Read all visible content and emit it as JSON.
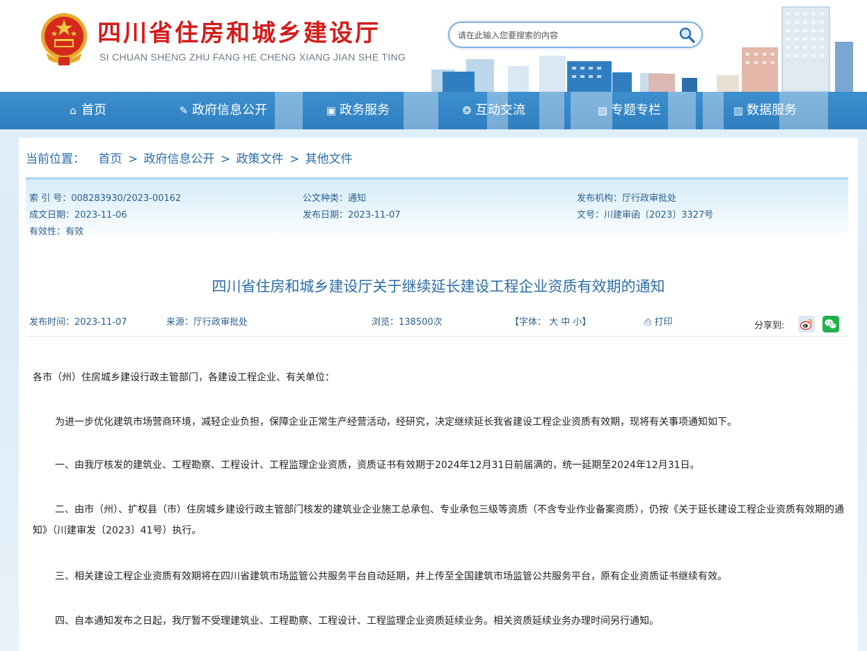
{
  "header": {
    "title": "四川省住房和城乡建设厅",
    "subtitle": "SI CHUAN SHENG ZHU FANG HE CHENG XIANG JIAN SHE TING",
    "emblem_icon": "national-emblem-icon",
    "search": {
      "placeholder": "请在此输入您要搜索的内容"
    }
  },
  "nav": {
    "items": [
      {
        "label": "首页",
        "icon": "home-icon"
      },
      {
        "label": "政府信息公开",
        "icon": "edit-icon"
      },
      {
        "label": "政务服务",
        "icon": "monitor-icon"
      },
      {
        "label": "互动交流",
        "icon": "chat-icon"
      },
      {
        "label": "专题专栏",
        "icon": "image-icon"
      },
      {
        "label": "数据服务",
        "icon": "chart-icon"
      }
    ]
  },
  "breadcrumb": {
    "label": "当前位置：",
    "items": [
      "首页",
      "政府信息公开",
      "政策文件",
      "其他文件"
    ],
    "separator": ">"
  },
  "meta": {
    "index_no": {
      "key": "索 引 号：",
      "value": "008283930/2023-00162"
    },
    "doc_type": {
      "key": "公文种类：",
      "value": "通知"
    },
    "publisher": {
      "key": "发布机构：",
      "value": "厅行政审批处"
    },
    "created_date": {
      "key": "成文日期：",
      "value": "2023-11-06"
    },
    "published_date": {
      "key": "发布日期：",
      "value": "2023-11-07"
    },
    "doc_no": {
      "key": "文号：",
      "value": "川建审函〔2023〕3327号"
    },
    "validity": {
      "key": "有效性：",
      "value": "有效"
    }
  },
  "article": {
    "title": "四川省住房和城乡建设厅关于继续延长建设工程企业资质有效期的通知",
    "publish_time": "发布时间：2023-11-07",
    "source": "来源：厅行政审批处",
    "views": "浏览：138500次",
    "font_size": "【字体： 大 中 小】",
    "print": "打印",
    "share_label": "分享到:",
    "paragraphs": [
      "各市（州）住房城乡建设行政主管部门，各建设工程企业、有关单位：",
      "为进一步优化建筑市场营商环境，减轻企业负担，保障企业正常生产经营活动，经研究，决定继续延长我省建设工程企业资质有效期，现将有关事项通知如下。",
      "一、由我厅核发的建筑业、工程勘察、工程设计、工程监理企业资质，资质证书有效期于2024年12月31日前届满的，统一延期至2024年12月31日。",
      "二、由市（州）、扩权县（市）住房城乡建设行政主管部门核发的建筑业企业施工总承包、专业承包三级等资质（不含专业作业备案资质），仍按《关于延长建设工程企业资质有效期的通知》（川建审发〔2023〕41号）执行。",
      "三、相关建设工程企业资质有效期将在四川省建筑市场监管公共服务平台自动延期，并上传至全国建筑市场监管公共服务平台，原有企业资质证书继续有效。",
      "四、自本通知发布之日起，我厅暂不受理建筑业、工程勘察、工程设计、工程监理企业资质延续业务。相关资质延续业务办理时间另行通知。"
    ]
  },
  "colors": {
    "title_red": "#d41c1c",
    "nav_blue": "#3a8bcb",
    "link_blue": "#2d6ca6"
  }
}
